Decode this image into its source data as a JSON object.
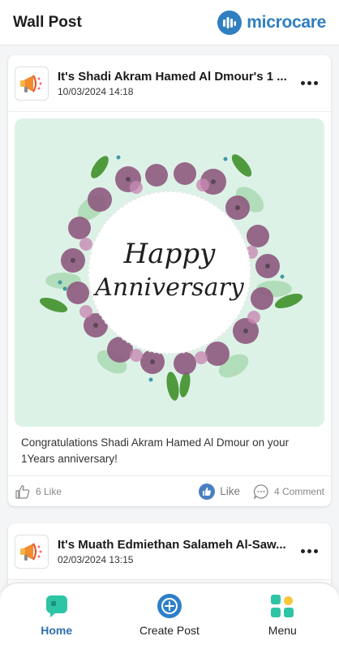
{
  "header": {
    "title": "Wall Post",
    "brand_name": "microcare"
  },
  "posts": [
    {
      "title": "It's Shadi Akram Hamed Al Dmour's 1 ...",
      "date": "10/03/2024 14:18",
      "image_text_line1": "Happy",
      "image_text_line2": "Anniversary",
      "body": "Congratulations Shadi Akram Hamed Al Dmour on your 1Years anniversary!",
      "likes_count": "6 Like",
      "like_label": "Like",
      "comments_count": "4 Comment"
    },
    {
      "title": "It's Muath Edmiethan Salameh Al-Saw...",
      "date": "02/03/2024 13:15"
    }
  ],
  "nav": {
    "home_label": "Home",
    "create_label": "Create Post",
    "menu_label": "Menu"
  },
  "colors": {
    "brand": "#2f7fc1",
    "active_nav": "#2e6fae",
    "like_blue": "#4b7fc2",
    "image_bg": "#ddf2e7"
  }
}
